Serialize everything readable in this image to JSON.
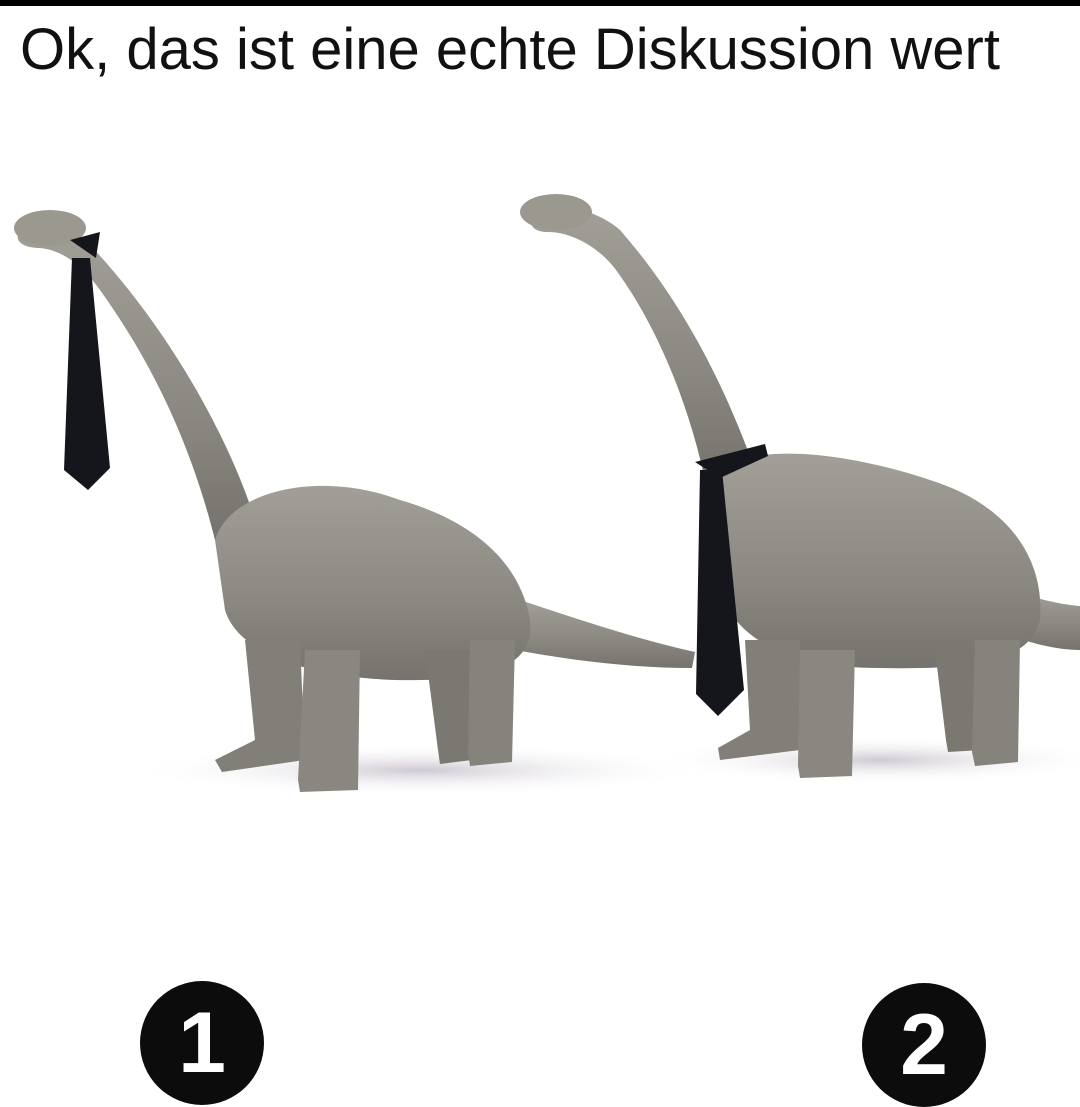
{
  "caption": "Ok, das ist eine echte Diskussion wert",
  "labels": {
    "option_1": "1",
    "option_2": "2"
  },
  "colors": {
    "dinosaur": "#8f8e86",
    "tie": "#14161c",
    "shadow": "#cfcbd0",
    "background": "#ffffff"
  }
}
